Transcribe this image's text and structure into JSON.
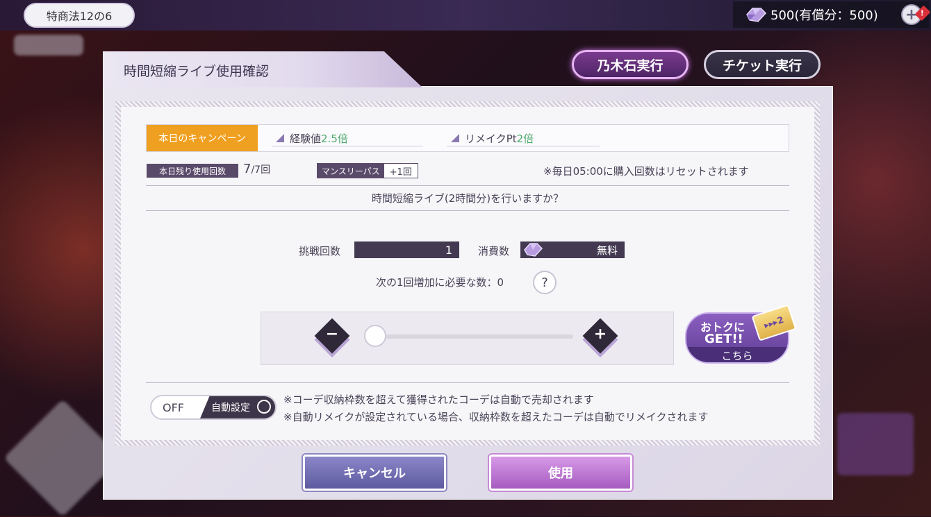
{
  "header": {
    "episode_tag": "特商法12の6",
    "currency_amount": "500(有償分：500)",
    "gem_icon": "gem-icon",
    "add_icon": "plus-icon"
  },
  "dialog": {
    "title": "時間短縮ライブ使用確認",
    "exec_stone_label": "乃木石実行",
    "exec_ticket_label": "チケット実行",
    "campaign": {
      "tag": "本日のキャンペーン",
      "bonuses": [
        {
          "label": "経験値",
          "value": "2.5倍"
        },
        {
          "label": "リメイクPt",
          "value": "2倍"
        }
      ]
    },
    "remaining": {
      "label": "本日残り使用回数",
      "current": "7",
      "total": "/7回"
    },
    "monthly_pass": {
      "label": "マンスリーパス",
      "bonus": "+1回"
    },
    "reset_note": "※毎日05:00に購入回数はリセットされます",
    "question": "時間短縮ライブ(2時間分)を行いますか？",
    "challenge_label": "挑戦回数",
    "challenge_value": "1",
    "cost_label": "消費数",
    "cost_value": "無料",
    "next_need": "次の1回増加に必要な数：0",
    "help_glyph": "?",
    "slider": {
      "min_glyph": "−",
      "plus_glyph": "+",
      "value": 1
    },
    "deal": {
      "line1": "おトクに",
      "line2": "GET!!",
      "line3": "こちら",
      "ticket_badge": "▸▸▸2"
    },
    "auto": {
      "state": "OFF",
      "label": "自動設定"
    },
    "notes": [
      "※コーデ収納枠数を超えて獲得されたコーデは自動で売却されます",
      "※自動リメイクが設定されている場合、収納枠数を超えたコーデは自動でリメイクされます"
    ],
    "cancel_label": "キャンセル",
    "use_label": "使用"
  },
  "colors": {
    "accent_orange": "#f0a020",
    "dark_box": "#433a52",
    "bonus_green": "#4aa86a"
  }
}
